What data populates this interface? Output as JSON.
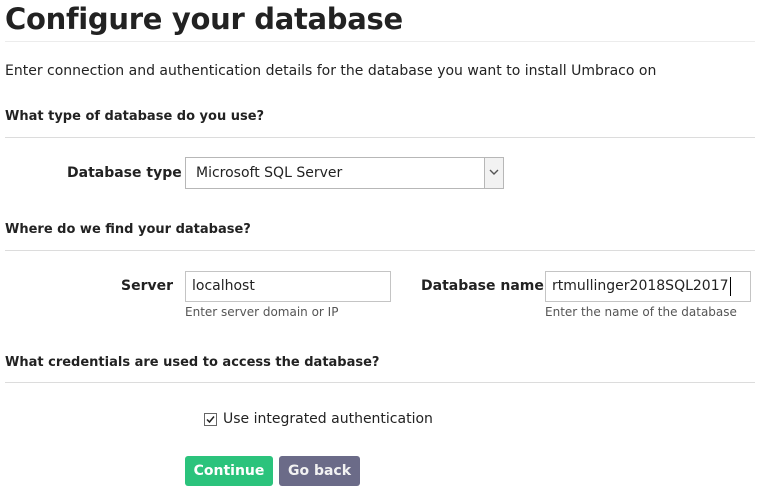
{
  "page": {
    "title": "Configure your database",
    "intro": "Enter connection and authentication details for the database you want to install Umbraco on"
  },
  "sections": {
    "type": {
      "heading": "What type of database do you use?"
    },
    "location": {
      "heading": "Where do we find your database?"
    },
    "credentials": {
      "heading": "What credentials are used to access the database?"
    }
  },
  "database_type": {
    "label": "Database type",
    "selected": "Microsoft SQL Server"
  },
  "server": {
    "label": "Server",
    "value": "localhost",
    "hint": "Enter server domain or IP"
  },
  "database_name": {
    "label": "Database name",
    "value": "rtmullinger2018SQL2017",
    "hint": "Enter the name of the database"
  },
  "integrated_auth": {
    "label": "Use integrated authentication",
    "checked": true
  },
  "actions": {
    "continue_label": "Continue",
    "back_label": "Go back"
  },
  "colors": {
    "continue_button": "#2bc37c",
    "back_button": "#6b6b88",
    "text": "#222222"
  },
  "icons": {
    "select_arrow": "chevron-down-icon",
    "checkbox_mark": "checkmark-icon"
  }
}
